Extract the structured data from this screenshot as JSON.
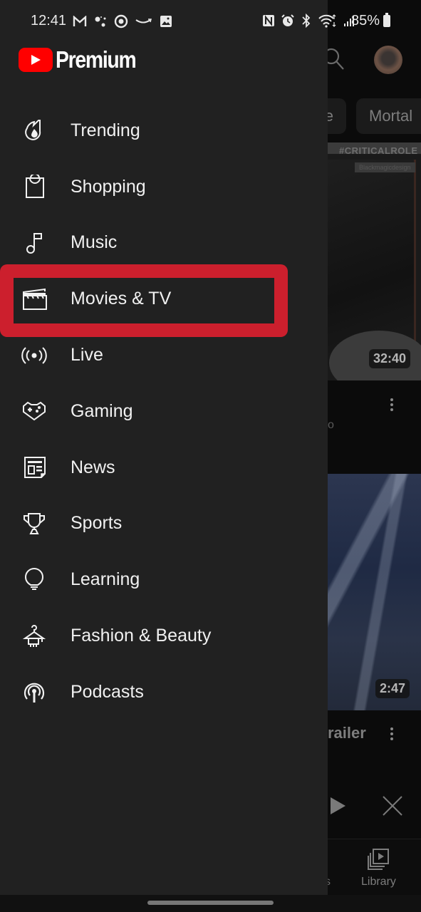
{
  "status_bar": {
    "time": "12:41",
    "left_icons": [
      "gmail-icon",
      "dots-icon",
      "target-icon",
      "amazon-icon",
      "gallery-icon"
    ],
    "right_icons": [
      "nfc-icon",
      "alarm-icon",
      "bluetooth-icon",
      "wifi-icon",
      "signal-icon"
    ],
    "battery_percent": "85%"
  },
  "drawer": {
    "brand": "Premium",
    "brand_color": "#ff0000",
    "items": [
      {
        "label": "Trending",
        "icon": "trending-icon"
      },
      {
        "label": "Shopping",
        "icon": "shopping-bag-icon"
      },
      {
        "label": "Music",
        "icon": "music-note-icon"
      },
      {
        "label": "Movies & TV",
        "icon": "clapperboard-icon",
        "highlighted": true
      },
      {
        "label": "Live",
        "icon": "live-broadcast-icon"
      },
      {
        "label": "Gaming",
        "icon": "gamepad-icon"
      },
      {
        "label": "News",
        "icon": "newspaper-icon"
      },
      {
        "label": "Sports",
        "icon": "trophy-icon"
      },
      {
        "label": "Learning",
        "icon": "lightbulb-icon"
      },
      {
        "label": "Fashion & Beauty",
        "icon": "hanger-icon"
      },
      {
        "label": "Podcasts",
        "icon": "podcast-icon"
      }
    ],
    "highlight_color": "#cc1f2d"
  },
  "background": {
    "chips": [
      "e",
      "Mortal"
    ],
    "video1": {
      "tag": "#CRITICALROLE",
      "sponsor": "Blackmagicdesign",
      "duration": "32:40",
      "sub_fragment": "o"
    },
    "video2": {
      "duration": "2:47",
      "title_fragment": "railer"
    },
    "bottom_nav": {
      "partial_label": "s",
      "library_label": "Library"
    }
  }
}
